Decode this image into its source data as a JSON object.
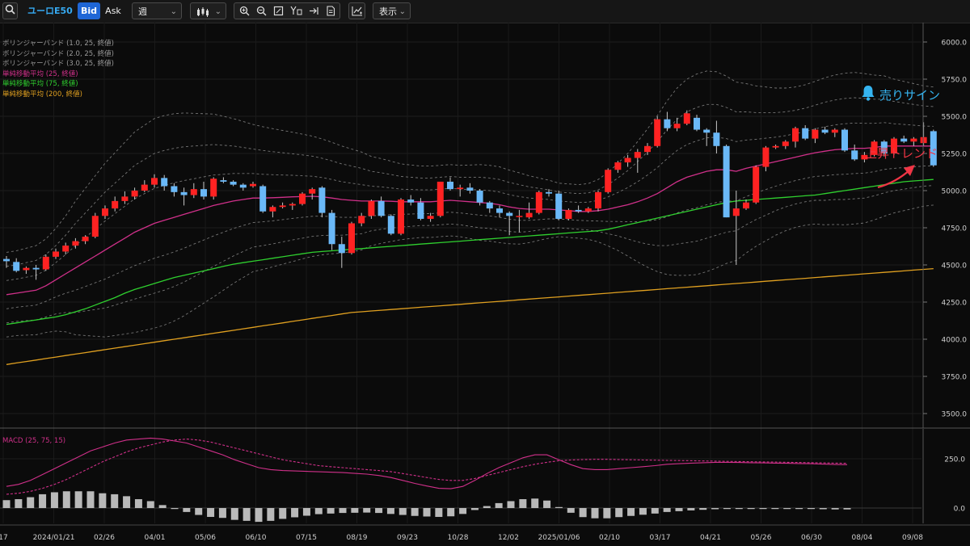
{
  "toolbar": {
    "symbol": "ユーロE50",
    "bid_label": "Bid",
    "ask_label": "Ask",
    "period_value": "週",
    "display_label": "表示"
  },
  "legend": [
    {
      "text": "ボリンジャーバンド (1.0, 25, 終値)",
      "color": "#9a9a9a"
    },
    {
      "text": "ボリンジャーバンド (2.0, 25, 終値)",
      "color": "#9a9a9a"
    },
    {
      "text": "ボリンジャーバンド (3.0, 25, 終値)",
      "color": "#9a9a9a"
    },
    {
      "text": "単純移動平均 (25, 終値)",
      "color": "#d0308a"
    },
    {
      "text": "単純移動平均 (75, 終値)",
      "color": "#2fd02f"
    },
    {
      "text": "単純移動平均 (200, 終値)",
      "color": "#e0a020"
    }
  ],
  "annotations": {
    "sell_sign": "売りサイン",
    "uptrend": "上昇トレンド"
  },
  "colors": {
    "up": "#ff2222",
    "down": "#6ab8f7",
    "sma25": "#d0308a",
    "sma75": "#2fd02f",
    "sma200": "#e0a020",
    "band": "#9a9a9a",
    "macd": "#d0308a",
    "histogram": "#b9b9b9",
    "sell_sign": "#35b4f0",
    "uptrend": "#f03545"
  },
  "chart_data": {
    "type": "candlestick",
    "timeframe": "週",
    "x_tick_labels": [
      "17",
      "2024/01/21",
      "02/26",
      "04/01",
      "05/06",
      "06/10",
      "07/15",
      "08/19",
      "09/23",
      "10/28",
      "12/02",
      "2025/01/06",
      "02/10",
      "03/17",
      "04/21",
      "05/26",
      "06/30",
      "08/04",
      "09/08"
    ],
    "price_axis": {
      "ticks": [
        "6000.0",
        "5750.0",
        "5500.0",
        "5250.0",
        "5000.0",
        "4750.0",
        "4500.0",
        "4250.0",
        "4000.0",
        "3750.0",
        "3500.0"
      ],
      "range": [
        3450,
        6080
      ]
    },
    "candles": [
      {
        "o": 4540,
        "h": 4560,
        "l": 4480,
        "c": 4525
      },
      {
        "o": 4520,
        "h": 4545,
        "l": 4450,
        "c": 4460
      },
      {
        "o": 4465,
        "h": 4490,
        "l": 4440,
        "c": 4480
      },
      {
        "o": 4480,
        "h": 4500,
        "l": 4400,
        "c": 4470
      },
      {
        "o": 4470,
        "h": 4570,
        "l": 4460,
        "c": 4555
      },
      {
        "o": 4555,
        "h": 4610,
        "l": 4540,
        "c": 4590
      },
      {
        "o": 4590,
        "h": 4650,
        "l": 4570,
        "c": 4630
      },
      {
        "o": 4630,
        "h": 4680,
        "l": 4610,
        "c": 4660
      },
      {
        "o": 4660,
        "h": 4700,
        "l": 4640,
        "c": 4690
      },
      {
        "o": 4690,
        "h": 4850,
        "l": 4680,
        "c": 4830
      },
      {
        "o": 4830,
        "h": 4900,
        "l": 4810,
        "c": 4880
      },
      {
        "o": 4880,
        "h": 4960,
        "l": 4860,
        "c": 4930
      },
      {
        "o": 4930,
        "h": 4995,
        "l": 4910,
        "c": 4960
      },
      {
        "o": 4960,
        "h": 5020,
        "l": 4940,
        "c": 5000
      },
      {
        "o": 5000,
        "h": 5070,
        "l": 4990,
        "c": 5040
      },
      {
        "o": 5040,
        "h": 5110,
        "l": 5020,
        "c": 5085
      },
      {
        "o": 5085,
        "h": 5105,
        "l": 5000,
        "c": 5030
      },
      {
        "o": 5030,
        "h": 5050,
        "l": 4960,
        "c": 4990
      },
      {
        "o": 4990,
        "h": 5020,
        "l": 4900,
        "c": 4970
      },
      {
        "o": 4970,
        "h": 5050,
        "l": 4950,
        "c": 5010
      },
      {
        "o": 5010,
        "h": 5060,
        "l": 4940,
        "c": 4960
      },
      {
        "o": 4960,
        "h": 5090,
        "l": 4940,
        "c": 5080
      },
      {
        "o": 5070,
        "h": 5090,
        "l": 5050,
        "c": 5060
      },
      {
        "o": 5060,
        "h": 5070,
        "l": 5030,
        "c": 5040
      },
      {
        "o": 5040,
        "h": 5050,
        "l": 5000,
        "c": 5020
      },
      {
        "o": 5030,
        "h": 5060,
        "l": 5020,
        "c": 5045
      },
      {
        "o": 5030,
        "h": 5040,
        "l": 4850,
        "c": 4860
      },
      {
        "o": 4860,
        "h": 4900,
        "l": 4820,
        "c": 4890
      },
      {
        "o": 4890,
        "h": 4920,
        "l": 4880,
        "c": 4900
      },
      {
        "o": 4900,
        "h": 4920,
        "l": 4870,
        "c": 4910
      },
      {
        "o": 4910,
        "h": 4990,
        "l": 4900,
        "c": 4980
      },
      {
        "o": 4980,
        "h": 5020,
        "l": 4940,
        "c": 5010
      },
      {
        "o": 5020,
        "h": 5030,
        "l": 4820,
        "c": 4850
      },
      {
        "o": 4850,
        "h": 4870,
        "l": 4600,
        "c": 4640
      },
      {
        "o": 4640,
        "h": 4690,
        "l": 4480,
        "c": 4580
      },
      {
        "o": 4580,
        "h": 4790,
        "l": 4570,
        "c": 4780
      },
      {
        "o": 4780,
        "h": 4850,
        "l": 4760,
        "c": 4830
      },
      {
        "o": 4830,
        "h": 4940,
        "l": 4810,
        "c": 4930
      },
      {
        "o": 4930,
        "h": 4960,
        "l": 4820,
        "c": 4830
      },
      {
        "o": 4830,
        "h": 4840,
        "l": 4700,
        "c": 4710
      },
      {
        "o": 4710,
        "h": 4950,
        "l": 4700,
        "c": 4940
      },
      {
        "o": 4940,
        "h": 4970,
        "l": 4900,
        "c": 4920
      },
      {
        "o": 4920,
        "h": 4950,
        "l": 4800,
        "c": 4810
      },
      {
        "o": 4810,
        "h": 4850,
        "l": 4790,
        "c": 4830
      },
      {
        "o": 4830,
        "h": 5060,
        "l": 4820,
        "c": 5060
      },
      {
        "o": 5060,
        "h": 5090,
        "l": 5000,
        "c": 5010
      },
      {
        "o": 5010,
        "h": 5040,
        "l": 4960,
        "c": 5020
      },
      {
        "o": 5020,
        "h": 5050,
        "l": 4980,
        "c": 5000
      },
      {
        "o": 5000,
        "h": 5010,
        "l": 4900,
        "c": 4920
      },
      {
        "o": 4920,
        "h": 4930,
        "l": 4850,
        "c": 4880
      },
      {
        "o": 4880,
        "h": 4900,
        "l": 4820,
        "c": 4850
      },
      {
        "o": 4850,
        "h": 4860,
        "l": 4700,
        "c": 4830
      },
      {
        "o": 4830,
        "h": 4870,
        "l": 4720,
        "c": 4830
      },
      {
        "o": 4820,
        "h": 4920,
        "l": 4810,
        "c": 4850
      },
      {
        "o": 4850,
        "h": 5000,
        "l": 4840,
        "c": 4990
      },
      {
        "o": 4990,
        "h": 5010,
        "l": 4960,
        "c": 4980
      },
      {
        "o": 4980,
        "h": 5000,
        "l": 4800,
        "c": 4810
      },
      {
        "o": 4810,
        "h": 4880,
        "l": 4800,
        "c": 4870
      },
      {
        "o": 4870,
        "h": 4900,
        "l": 4850,
        "c": 4860
      },
      {
        "o": 4860,
        "h": 4890,
        "l": 4850,
        "c": 4880
      },
      {
        "o": 4880,
        "h": 5000,
        "l": 4860,
        "c": 4990
      },
      {
        "o": 4990,
        "h": 5150,
        "l": 4980,
        "c": 5140
      },
      {
        "o": 5140,
        "h": 5200,
        "l": 5120,
        "c": 5190
      },
      {
        "o": 5190,
        "h": 5240,
        "l": 5160,
        "c": 5220
      },
      {
        "o": 5220,
        "h": 5280,
        "l": 5120,
        "c": 5260
      },
      {
        "o": 5260,
        "h": 5320,
        "l": 5240,
        "c": 5300
      },
      {
        "o": 5300,
        "h": 5500,
        "l": 5290,
        "c": 5480
      },
      {
        "o": 5480,
        "h": 5530,
        "l": 5400,
        "c": 5420
      },
      {
        "o": 5420,
        "h": 5490,
        "l": 5400,
        "c": 5450
      },
      {
        "o": 5450,
        "h": 5540,
        "l": 5440,
        "c": 5520
      },
      {
        "o": 5490,
        "h": 5510,
        "l": 5400,
        "c": 5410
      },
      {
        "o": 5410,
        "h": 5420,
        "l": 5300,
        "c": 5390
      },
      {
        "o": 5390,
        "h": 5470,
        "l": 5250,
        "c": 5300
      },
      {
        "o": 5300,
        "h": 5310,
        "l": 4820,
        "c": 4820
      },
      {
        "o": 4830,
        "h": 5000,
        "l": 4500,
        "c": 4880
      },
      {
        "o": 4880,
        "h": 4940,
        "l": 4870,
        "c": 4920
      },
      {
        "o": 4920,
        "h": 5170,
        "l": 4910,
        "c": 5160
      },
      {
        "o": 5160,
        "h": 5300,
        "l": 5130,
        "c": 5290
      },
      {
        "o": 5290,
        "h": 5310,
        "l": 5280,
        "c": 5300
      },
      {
        "o": 5300,
        "h": 5340,
        "l": 5280,
        "c": 5330
      },
      {
        "o": 5330,
        "h": 5430,
        "l": 5290,
        "c": 5420
      },
      {
        "o": 5420,
        "h": 5440,
        "l": 5340,
        "c": 5350
      },
      {
        "o": 5350,
        "h": 5420,
        "l": 5320,
        "c": 5410
      },
      {
        "o": 5410,
        "h": 5430,
        "l": 5380,
        "c": 5390
      },
      {
        "o": 5390,
        "h": 5420,
        "l": 5360,
        "c": 5410
      },
      {
        "o": 5410,
        "h": 5420,
        "l": 5260,
        "c": 5270
      },
      {
        "o": 5270,
        "h": 5310,
        "l": 5200,
        "c": 5210
      },
      {
        "o": 5210,
        "h": 5260,
        "l": 5190,
        "c": 5240
      },
      {
        "o": 5240,
        "h": 5340,
        "l": 5230,
        "c": 5330
      },
      {
        "o": 5330,
        "h": 5340,
        "l": 5230,
        "c": 5250
      },
      {
        "o": 5250,
        "h": 5360,
        "l": 5240,
        "c": 5350
      },
      {
        "o": 5350,
        "h": 5370,
        "l": 5320,
        "c": 5330
      },
      {
        "o": 5330,
        "h": 5360,
        "l": 5300,
        "c": 5350
      },
      {
        "o": 5320,
        "h": 5460,
        "l": 5300,
        "c": 5360
      },
      {
        "o": 5400,
        "h": 5410,
        "l": 5160,
        "c": 5170
      }
    ],
    "sma25": [
      4300,
      4310,
      4320,
      4330,
      4360,
      4400,
      4440,
      4480,
      4520,
      4560,
      4600,
      4640,
      4680,
      4720,
      4750,
      4780,
      4800,
      4820,
      4840,
      4860,
      4880,
      4900,
      4915,
      4930,
      4940,
      4950,
      4950,
      4952,
      4955,
      4958,
      4960,
      4962,
      4958,
      4950,
      4940,
      4935,
      4930,
      4930,
      4930,
      4928,
      4925,
      4925,
      4925,
      4925,
      4930,
      4935,
      4930,
      4925,
      4920,
      4915,
      4905,
      4890,
      4880,
      4875,
      4875,
      4875,
      4870,
      4865,
      4860,
      4860,
      4865,
      4875,
      4890,
      4905,
      4925,
      4950,
      4980,
      5020,
      5060,
      5090,
      5110,
      5130,
      5140,
      5140,
      5130,
      5150,
      5165,
      5180,
      5195,
      5210,
      5225,
      5240,
      5255,
      5265,
      5275,
      5280,
      5285,
      5285,
      5290,
      5300,
      5300,
      5300,
      5300,
      5300,
      5300
    ],
    "sma75": [
      4100,
      4110,
      4120,
      4130,
      4140,
      4150,
      4165,
      4185,
      4205,
      4230,
      4255,
      4280,
      4310,
      4335,
      4355,
      4375,
      4395,
      4415,
      4430,
      4445,
      4460,
      4475,
      4490,
      4505,
      4515,
      4525,
      4535,
      4545,
      4555,
      4565,
      4575,
      4585,
      4590,
      4595,
      4600,
      4605,
      4610,
      4615,
      4620,
      4625,
      4630,
      4635,
      4640,
      4645,
      4650,
      4655,
      4660,
      4665,
      4670,
      4675,
      4680,
      4685,
      4690,
      4695,
      4700,
      4705,
      4710,
      4715,
      4720,
      4725,
      4730,
      4740,
      4755,
      4770,
      4785,
      4800,
      4815,
      4830,
      4845,
      4860,
      4875,
      4890,
      4905,
      4920,
      4930,
      4935,
      4940,
      4945,
      4950,
      4955,
      4960,
      4965,
      4970,
      4980,
      4990,
      5000,
      5010,
      5020,
      5030,
      5040,
      5050,
      5060,
      5065,
      5070,
      5075
    ],
    "sma200": [
      3830,
      3840,
      3850,
      3860,
      3870,
      3880,
      3890,
      3900,
      3910,
      3920,
      3930,
      3940,
      3950,
      3960,
      3970,
      3980,
      3990,
      4000,
      4010,
      4020,
      4030,
      4040,
      4050,
      4060,
      4070,
      4080,
      4090,
      4100,
      4110,
      4120,
      4130,
      4140,
      4150,
      4160,
      4170,
      4180,
      4185,
      4190,
      4195,
      4200,
      4205,
      4210,
      4215,
      4220,
      4225,
      4230,
      4235,
      4240,
      4245,
      4250,
      4255,
      4260,
      4265,
      4270,
      4275,
      4280,
      4285,
      4290,
      4295,
      4300,
      4305,
      4310,
      4315,
      4320,
      4325,
      4330,
      4335,
      4340,
      4345,
      4350,
      4355,
      4360,
      4365,
      4370,
      4375,
      4380,
      4385,
      4390,
      4395,
      4400,
      4405,
      4410,
      4415,
      4420,
      4425,
      4430,
      4435,
      4440,
      4445,
      4450,
      4455,
      4460,
      4465,
      4470,
      4475
    ],
    "band_width_2sigma": [
      190,
      190,
      195,
      200,
      210,
      230,
      260,
      300,
      330,
      360,
      390,
      410,
      430,
      450,
      460,
      470,
      470,
      465,
      455,
      440,
      425,
      410,
      390,
      370,
      350,
      330,
      320,
      310,
      300,
      290,
      280,
      270,
      260,
      250,
      240,
      230,
      220,
      200,
      190,
      180,
      170,
      165,
      160,
      160,
      160,
      160,
      160,
      165,
      170,
      170,
      170,
      165,
      160,
      150,
      140,
      130,
      120,
      120,
      120,
      125,
      140,
      165,
      195,
      230,
      270,
      310,
      350,
      390,
      420,
      440,
      450,
      450,
      440,
      420,
      400,
      380,
      360,
      345,
      330,
      320,
      315,
      315,
      320,
      330,
      335,
      340,
      340,
      335,
      325,
      315,
      300,
      290,
      280,
      270,
      265
    ],
    "macd_axis_ticks": [
      "250.0",
      "0.0"
    ],
    "macd_title": "MACD (25, 75, 15)",
    "macd": [
      110,
      120,
      140,
      170,
      200,
      230,
      260,
      290,
      310,
      330,
      345,
      350,
      355,
      350,
      340,
      330,
      310,
      290,
      270,
      245,
      225,
      205,
      195,
      190,
      188,
      186,
      184,
      182,
      180,
      176,
      172,
      165,
      155,
      140,
      125,
      112,
      100,
      98,
      110,
      140,
      175,
      205,
      230,
      255,
      270,
      270,
      245,
      220,
      200,
      195,
      195,
      200,
      205,
      210,
      215,
      222,
      225,
      228,
      230,
      232,
      232,
      231,
      230,
      229,
      228,
      227,
      226,
      225,
      223,
      221,
      220
    ],
    "macd_signal": [
      70,
      75,
      85,
      100,
      120,
      145,
      175,
      205,
      235,
      260,
      285,
      305,
      320,
      335,
      345,
      350,
      345,
      335,
      320,
      305,
      290,
      275,
      260,
      245,
      235,
      225,
      215,
      210,
      205,
      200,
      195,
      190,
      185,
      175,
      165,
      155,
      145,
      140,
      140,
      150,
      165,
      180,
      195,
      210,
      222,
      232,
      240,
      244,
      246,
      247,
      247,
      246,
      245,
      244,
      243,
      242,
      241,
      240,
      239,
      238,
      237,
      236,
      235,
      234,
      233,
      232,
      231,
      230,
      229,
      228,
      227
    ],
    "histogram": [
      40,
      45,
      55,
      70,
      80,
      85,
      85,
      85,
      75,
      70,
      60,
      45,
      35,
      15,
      -5,
      -20,
      -35,
      -45,
      -50,
      -60,
      -65,
      -70,
      -65,
      -55,
      -47,
      -39,
      -31,
      -28,
      -25,
      -24,
      -23,
      -25,
      -30,
      -35,
      -40,
      -43,
      -45,
      -42,
      -30,
      -10,
      10,
      25,
      35,
      45,
      48,
      38,
      5,
      -24,
      -46,
      -52,
      -52,
      -46,
      -40,
      -34,
      -28,
      -20,
      -16,
      -12,
      -9,
      -6,
      -5,
      -5,
      -5,
      -5,
      -5,
      -5,
      -5,
      -5,
      -6,
      -7,
      -7
    ]
  }
}
